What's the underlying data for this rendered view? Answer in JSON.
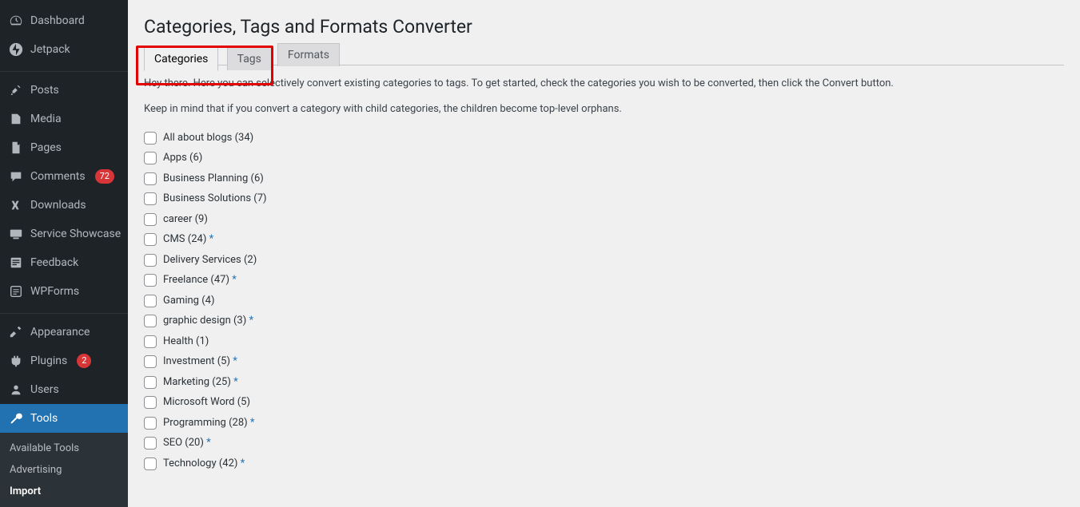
{
  "sidebar": {
    "items": [
      {
        "icon": "dashboard",
        "label": "Dashboard"
      },
      {
        "icon": "jetpack",
        "label": "Jetpack"
      },
      {
        "separator": true
      },
      {
        "icon": "pin",
        "label": "Posts"
      },
      {
        "icon": "media",
        "label": "Media"
      },
      {
        "icon": "pages",
        "label": "Pages"
      },
      {
        "icon": "comment",
        "label": "Comments",
        "badge": "72"
      },
      {
        "icon": "download",
        "label": "Downloads"
      },
      {
        "icon": "showcase",
        "label": "Service Showcase"
      },
      {
        "icon": "feedback",
        "label": "Feedback"
      },
      {
        "icon": "wpforms",
        "label": "WPForms"
      },
      {
        "separator": true
      },
      {
        "icon": "appearance",
        "label": "Appearance"
      },
      {
        "icon": "plugin",
        "label": "Plugins",
        "badge": "2"
      },
      {
        "icon": "users",
        "label": "Users"
      },
      {
        "icon": "tools",
        "label": "Tools",
        "active": true
      }
    ],
    "submenu": [
      {
        "label": "Available Tools"
      },
      {
        "label": "Advertising"
      },
      {
        "label": "Import",
        "current": true
      }
    ]
  },
  "page": {
    "title": "Categories, Tags and Formats Converter",
    "tabs": [
      {
        "label": "Categories",
        "active": true
      },
      {
        "label": "Tags"
      },
      {
        "label": "Formats"
      }
    ],
    "desc1": "Hey there. Here you can selectively convert existing categories to tags. To get started, check the categories you wish to be converted, then click the Convert button.",
    "desc2": "Keep in mind that if you convert a category with child categories, the children become top-level orphans.",
    "categories": [
      {
        "name": "All about blogs",
        "count": 34
      },
      {
        "name": "Apps",
        "count": 6
      },
      {
        "name": "Business Planning",
        "count": 6
      },
      {
        "name": "Business Solutions",
        "count": 7
      },
      {
        "name": "career",
        "count": 9
      },
      {
        "name": "CMS",
        "count": 24,
        "star": true
      },
      {
        "name": "Delivery Services",
        "count": 2
      },
      {
        "name": "Freelance",
        "count": 47,
        "star": true
      },
      {
        "name": "Gaming",
        "count": 4
      },
      {
        "name": "graphic design",
        "count": 3,
        "star": true
      },
      {
        "name": "Health",
        "count": 1
      },
      {
        "name": "Investment",
        "count": 5,
        "star": true
      },
      {
        "name": "Marketing",
        "count": 25,
        "star": true
      },
      {
        "name": "Microsoft Word",
        "count": 5
      },
      {
        "name": "Programming",
        "count": 28,
        "star": true
      },
      {
        "name": "SEO",
        "count": 20,
        "star": true
      },
      {
        "name": "Technology",
        "count": 42,
        "star": true
      }
    ]
  }
}
